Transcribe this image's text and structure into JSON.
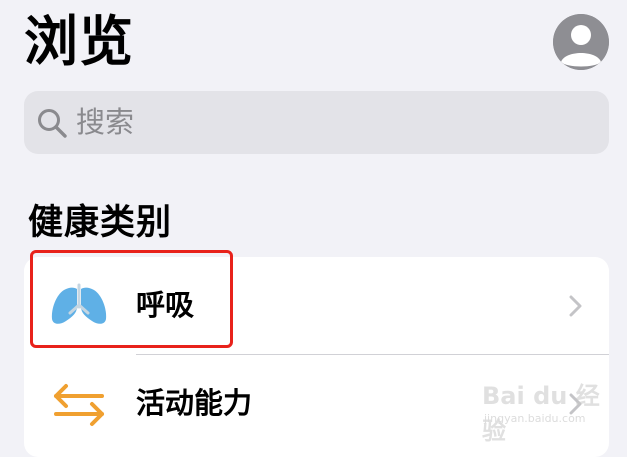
{
  "header": {
    "title": "浏览",
    "avatar_icon": "person-circle-icon"
  },
  "search": {
    "placeholder": "搜索",
    "icon": "search-icon"
  },
  "section": {
    "title": "健康类别"
  },
  "categories": [
    {
      "label": "呼吸",
      "icon": "lungs-icon",
      "icon_color": "#5fb0e6",
      "highlighted": true
    },
    {
      "label": "活动能力",
      "icon": "arrows-exchange-icon",
      "icon_color": "#f0a030",
      "highlighted": false
    }
  ],
  "annotation": {
    "highlight_color": "#e8221b"
  },
  "watermark": {
    "brand": "Bai du 经验",
    "url": "jingyan.baidu.com"
  },
  "colors": {
    "background": "#f2f2f7",
    "card": "#ffffff",
    "search_bg": "#e3e3e8",
    "secondary_text": "#8a8a8e"
  }
}
